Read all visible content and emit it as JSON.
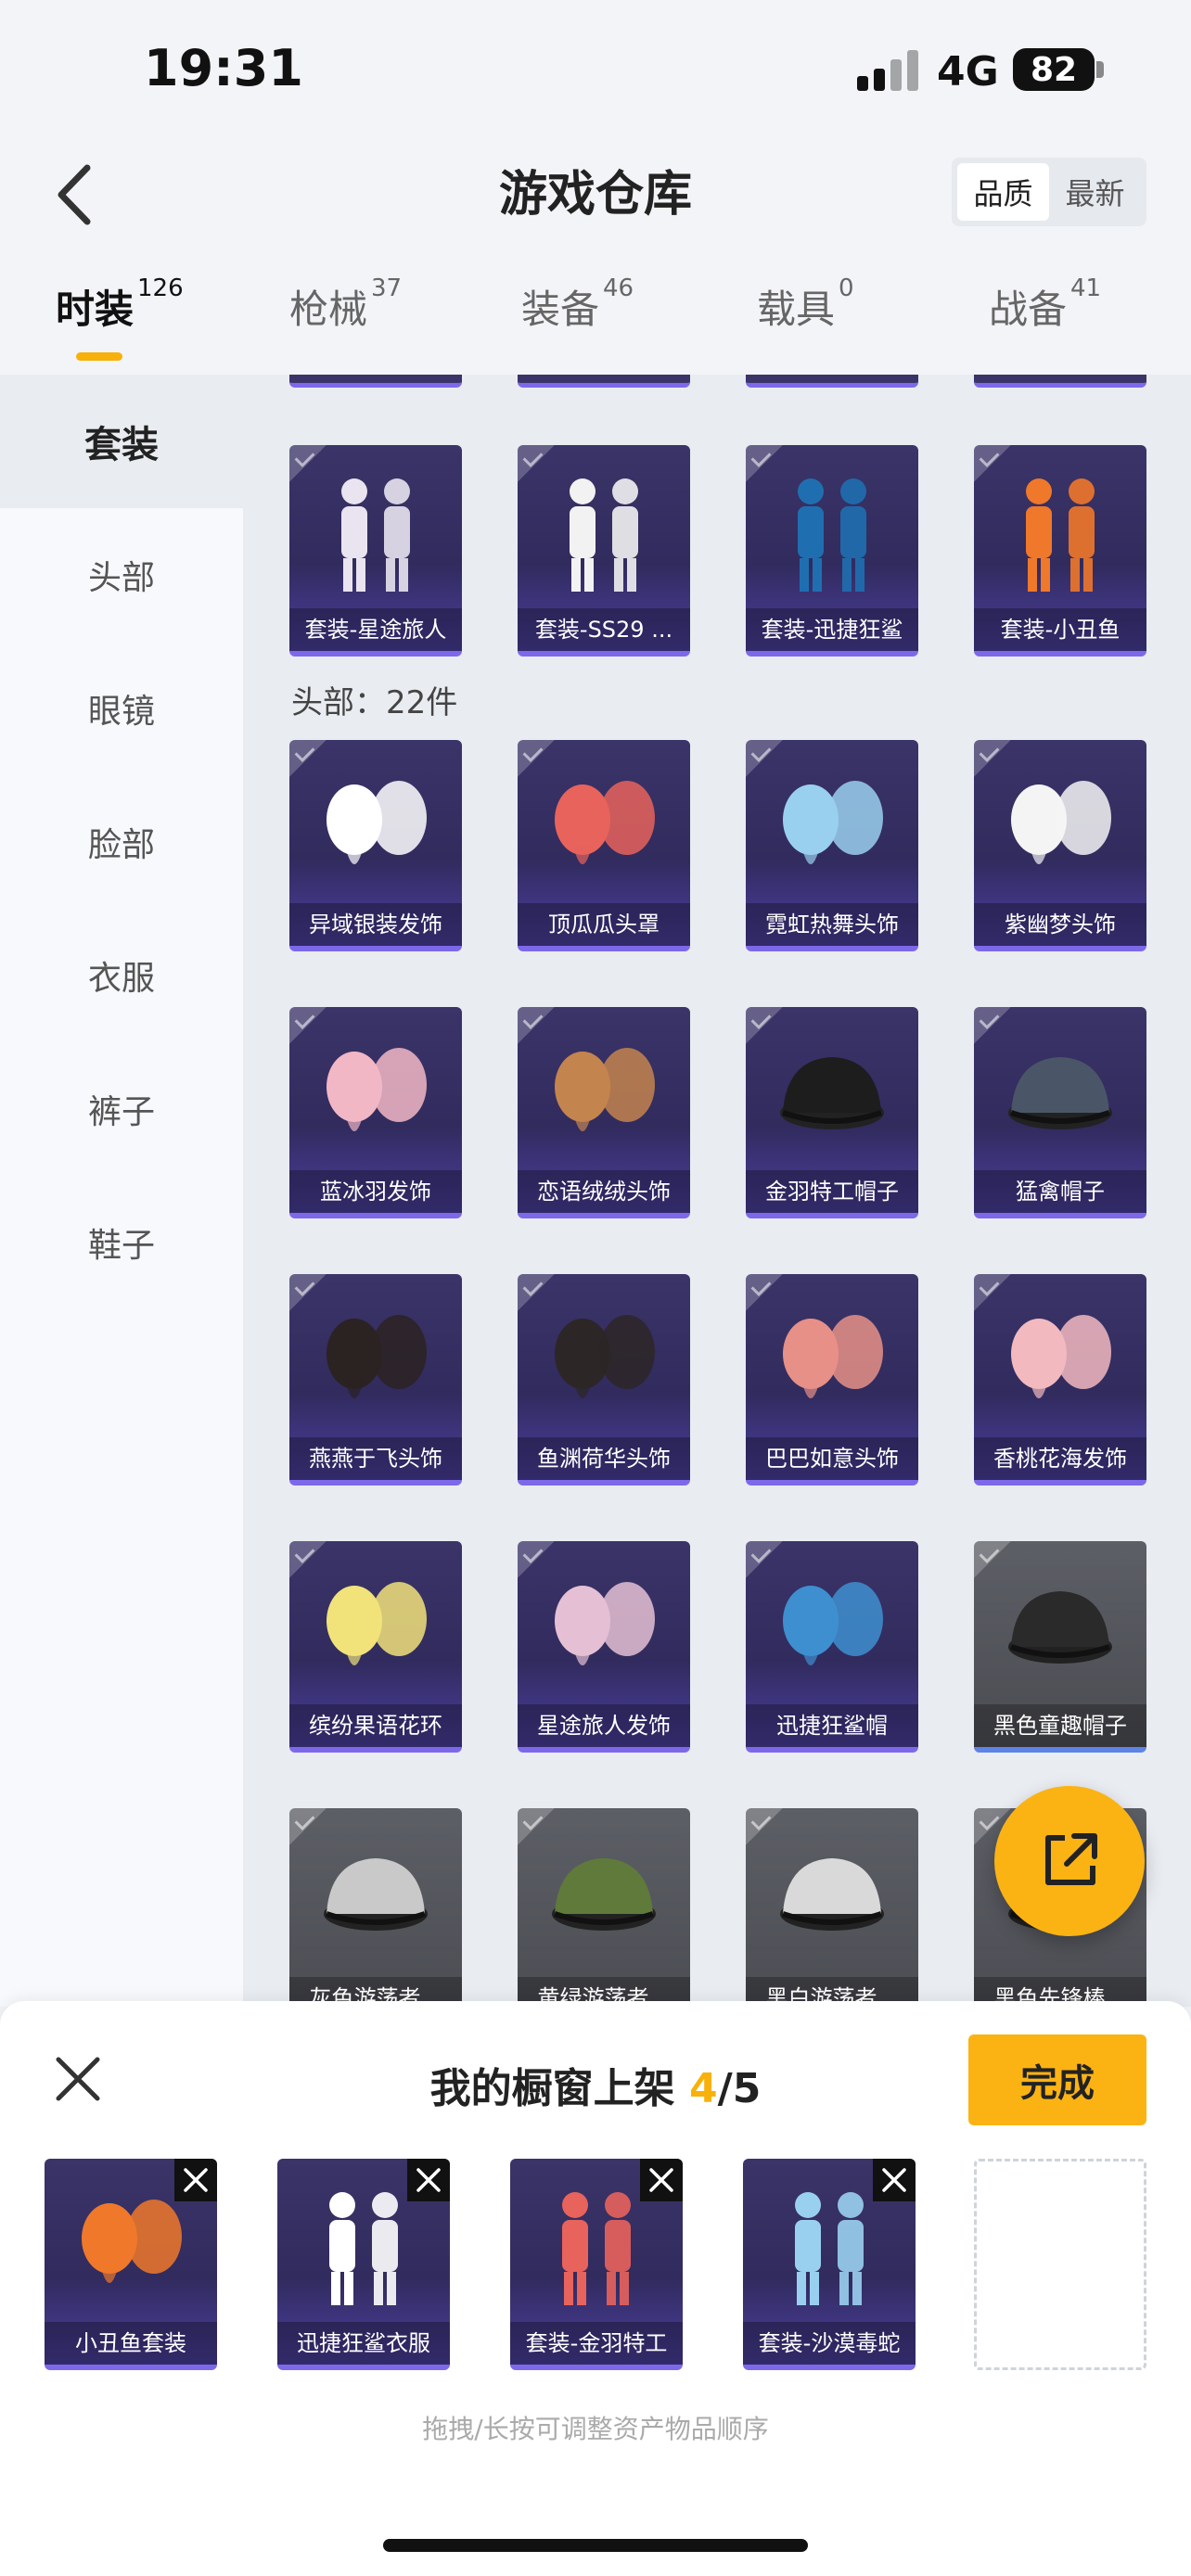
{
  "status_bar": {
    "time": "19:31",
    "network": "4G",
    "battery": "82"
  },
  "header": {
    "title": "游戏仓库",
    "sort_quality": "品质",
    "sort_newest": "最新",
    "back_icon": "chevron-left-icon"
  },
  "tabs": [
    {
      "label": "时装",
      "count": "126",
      "active": true
    },
    {
      "label": "枪械",
      "count": "37"
    },
    {
      "label": "装备",
      "count": "46"
    },
    {
      "label": "载具",
      "count": "0"
    },
    {
      "label": "战备",
      "count": "41"
    }
  ],
  "sidebar": [
    {
      "label": "套装",
      "active": true
    },
    {
      "label": "头部"
    },
    {
      "label": "眼镜"
    },
    {
      "label": "脸部"
    },
    {
      "label": "衣服"
    },
    {
      "label": "裤子"
    },
    {
      "label": "鞋子"
    }
  ],
  "suits": [
    {
      "label": "套装-星途旅人",
      "quality": "purple"
    },
    {
      "label": "套装-SS29 ...",
      "quality": "purple"
    },
    {
      "label": "套装-迅捷狂鲨",
      "quality": "purple"
    },
    {
      "label": "套装-小丑鱼",
      "quality": "purple"
    }
  ],
  "head_section_label": "头部：22件",
  "head_items": [
    {
      "label": "异域银装发饰",
      "quality": "purple"
    },
    {
      "label": "顶瓜瓜头罩",
      "quality": "purple"
    },
    {
      "label": "霓虹热舞头饰",
      "quality": "purple"
    },
    {
      "label": "紫幽梦头饰",
      "quality": "purple"
    },
    {
      "label": "蓝冰羽发饰",
      "quality": "purple"
    },
    {
      "label": "恋语绒绒头饰",
      "quality": "purple"
    },
    {
      "label": "金羽特工帽子",
      "quality": "purple"
    },
    {
      "label": "猛禽帽子",
      "quality": "purple"
    },
    {
      "label": "燕燕于飞头饰",
      "quality": "purple"
    },
    {
      "label": "鱼渊荷华头饰",
      "quality": "purple"
    },
    {
      "label": "巴巴如意头饰",
      "quality": "purple"
    },
    {
      "label": "香桃花海发饰",
      "quality": "purple"
    },
    {
      "label": "缤纷果语花环",
      "quality": "purple"
    },
    {
      "label": "星途旅人发饰",
      "quality": "purple"
    },
    {
      "label": "迅捷狂鲨帽",
      "quality": "purple"
    },
    {
      "label": "黑色童趣帽子",
      "quality": "gray"
    },
    {
      "label": "灰色游荡者...",
      "quality": "gray"
    },
    {
      "label": "黄绿游荡者...",
      "quality": "gray"
    },
    {
      "label": "黑白游荡者...",
      "quality": "gray"
    },
    {
      "label": "黑色先锋棒...",
      "quality": "gray"
    }
  ],
  "fab_icon": "share-external-icon",
  "showcase": {
    "title": "我的橱窗上架",
    "current": "4",
    "total": "/5",
    "done_label": "完成",
    "slots": [
      {
        "label": "小丑鱼套装"
      },
      {
        "label": "迅捷狂鲨衣服"
      },
      {
        "label": "套装-金羽特工"
      },
      {
        "label": "套装-沙漠毒蛇"
      }
    ],
    "hint": "拖拽/长按可调整资产物品顺序"
  }
}
